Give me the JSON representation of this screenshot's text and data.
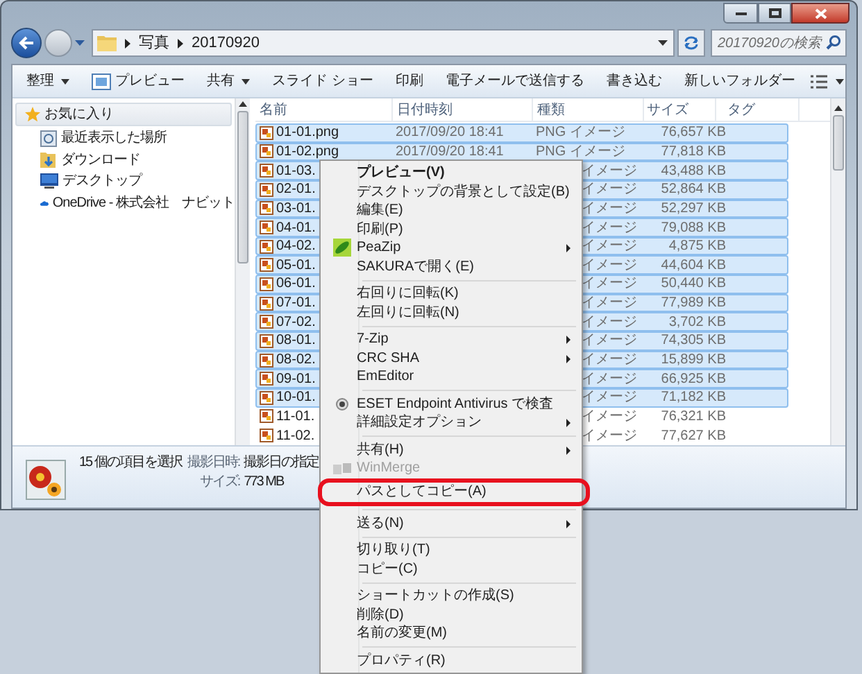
{
  "address": {
    "crumbs": [
      "写真",
      "20170920"
    ],
    "search_placeholder": "20170920の検索"
  },
  "toolbar": [
    {
      "label": "整理",
      "dropdown": true
    },
    {
      "label": "プレビュー",
      "dropdown": false
    },
    {
      "label": "共有",
      "dropdown": true
    },
    {
      "label": "スライド ショー",
      "dropdown": false
    },
    {
      "label": "印刷",
      "dropdown": false
    },
    {
      "label": "電子メールで送信する",
      "dropdown": false
    },
    {
      "label": "書き込む",
      "dropdown": false
    },
    {
      "label": "新しいフォルダー",
      "dropdown": false
    }
  ],
  "nav": {
    "header": "お気に入り",
    "items": [
      {
        "label": "最近表示した場所"
      },
      {
        "label": "ダウンロード"
      },
      {
        "label": "デスクトップ"
      },
      {
        "label": "OneDrive - 株式会社　ナビット"
      }
    ]
  },
  "columns": [
    "名前",
    "日付時刻",
    "種類",
    "サイズ",
    "タグ"
  ],
  "rows": [
    {
      "name": "01-01.png",
      "date": "2017/09/20 18:41",
      "type": "PNG イメージ",
      "size": "76,657 KB",
      "selected": true
    },
    {
      "name": "01-02.png",
      "date": "2017/09/20 18:41",
      "type": "PNG イメージ",
      "size": "77,818 KB",
      "selected": true
    },
    {
      "name": "01-03.",
      "type": "イメージ",
      "size": "43,488 KB",
      "selected": true
    },
    {
      "name": "02-01.",
      "type": "イメージ",
      "size": "52,864 KB",
      "selected": true
    },
    {
      "name": "03-01.",
      "type": "イメージ",
      "size": "52,297 KB",
      "selected": true
    },
    {
      "name": "04-01.",
      "type": "イメージ",
      "size": "79,088 KB",
      "selected": true
    },
    {
      "name": "04-02.",
      "type": "イメージ",
      "size": "4,875 KB",
      "selected": true
    },
    {
      "name": "05-01.",
      "type": "イメージ",
      "size": "44,604 KB",
      "selected": true
    },
    {
      "name": "06-01.",
      "type": "イメージ",
      "size": "50,440 KB",
      "selected": true
    },
    {
      "name": "07-01.",
      "type": "イメージ",
      "size": "77,989 KB",
      "selected": true
    },
    {
      "name": "07-02.",
      "type": "イメージ",
      "size": "3,702 KB",
      "selected": true
    },
    {
      "name": "08-01.",
      "type": "イメージ",
      "size": "74,305 KB",
      "selected": true
    },
    {
      "name": "08-02.",
      "type": "イメージ",
      "size": "15,899 KB",
      "selected": true
    },
    {
      "name": "09-01.",
      "type": "イメージ",
      "size": "66,925 KB",
      "selected": true
    },
    {
      "name": "10-01.",
      "type": "イメージ",
      "size": "71,182 KB",
      "selected": true
    },
    {
      "name": "11-01.",
      "type": "イメージ",
      "size": "76,321 KB",
      "selected": false
    },
    {
      "name": "11-02.",
      "type": "イメージ",
      "size": "77,627 KB",
      "selected": false
    }
  ],
  "status": {
    "count": "15 個の項目を選択",
    "fields": [
      {
        "label": "撮影日時:",
        "value": "撮影日の指定"
      },
      {
        "label": "サイズ:",
        "value": "773 MB"
      }
    ]
  },
  "menu": [
    {
      "kind": "item",
      "label": "プレビュー(V)",
      "bold": true
    },
    {
      "kind": "item",
      "label": "デスクトップの背景として設定(B)"
    },
    {
      "kind": "item",
      "label": "編集(E)"
    },
    {
      "kind": "item",
      "label": "印刷(P)"
    },
    {
      "kind": "item",
      "label": "PeaZip",
      "submenu": true
    },
    {
      "kind": "item",
      "label": "SAKURAで開く(E)"
    },
    {
      "kind": "separator"
    },
    {
      "kind": "item",
      "label": "右回りに回転(K)"
    },
    {
      "kind": "item",
      "label": "左回りに回転(N)"
    },
    {
      "kind": "separator"
    },
    {
      "kind": "item",
      "label": "7-Zip",
      "submenu": true
    },
    {
      "kind": "item",
      "label": "CRC SHA",
      "submenu": true
    },
    {
      "kind": "item",
      "label": "EmEditor"
    },
    {
      "kind": "separator"
    },
    {
      "kind": "item",
      "label": "ESET Endpoint Antivirus で検査"
    },
    {
      "kind": "item",
      "label": "詳細設定オプション",
      "submenu": true
    },
    {
      "kind": "separator"
    },
    {
      "kind": "item",
      "label": "共有(H)",
      "submenu": true
    },
    {
      "kind": "item",
      "label": "WinMerge",
      "disabled": true
    },
    {
      "kind": "item",
      "label": "パスとしてコピー(A)",
      "circled": true
    },
    {
      "kind": "separator"
    },
    {
      "kind": "item",
      "label": "送る(N)",
      "submenu": true
    },
    {
      "kind": "separator"
    },
    {
      "kind": "item",
      "label": "切り取り(T)"
    },
    {
      "kind": "item",
      "label": "コピー(C)"
    },
    {
      "kind": "separator"
    },
    {
      "kind": "item",
      "label": "ショートカットの作成(S)"
    },
    {
      "kind": "item",
      "label": "削除(D)"
    },
    {
      "kind": "item",
      "label": "名前の変更(M)"
    },
    {
      "kind": "separator"
    },
    {
      "kind": "item",
      "label": "プロパティ(R)"
    }
  ]
}
